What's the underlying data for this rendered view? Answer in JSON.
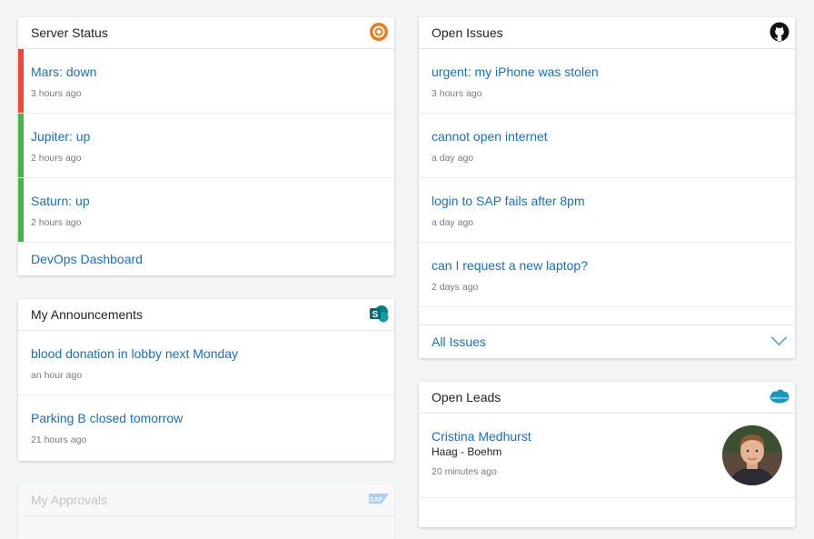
{
  "server_status": {
    "title": "Server Status",
    "logo_icon": "devops-ring-icon",
    "items": [
      {
        "label": "Mars: down",
        "time": "3 hours ago",
        "status_color": "#f0453a"
      },
      {
        "label": "Jupiter: up",
        "time": "2 hours ago",
        "status_color": "#47b14a"
      },
      {
        "label": "Saturn: up",
        "time": "2 hours ago",
        "status_color": "#47b14a"
      }
    ],
    "footer": "DevOps Dashboard"
  },
  "announcements": {
    "title": "My Announcements",
    "logo_icon": "sharepoint-icon",
    "items": [
      {
        "label": "blood donation in lobby next Monday",
        "time": "an hour ago"
      },
      {
        "label": "Parking B closed tomorrow",
        "time": "21 hours ago"
      }
    ]
  },
  "approvals": {
    "title": "My Approvals",
    "logo_icon": "sap-icon"
  },
  "open_issues": {
    "title": "Open Issues",
    "logo_icon": "github-icon",
    "items": [
      {
        "label": "urgent: my iPhone was stolen",
        "time": "3 hours ago"
      },
      {
        "label": "cannot open internet",
        "time": "a day ago"
      },
      {
        "label": "login to SAP fails after 8pm",
        "time": "a day ago"
      },
      {
        "label": "can I request a new laptop?",
        "time": "2 days ago"
      }
    ],
    "footer": "All Issues"
  },
  "open_leads": {
    "title": "Open Leads",
    "logo_icon": "salesforce-icon",
    "items": [
      {
        "name": "Cristina Medhurst",
        "company": "Haag - Boehm",
        "time": "20 minutes ago"
      }
    ]
  },
  "colors": {
    "link": "#1a6ec2",
    "down": "#f0453a",
    "up": "#47b14a",
    "accent_orange": "#f07a1a"
  }
}
